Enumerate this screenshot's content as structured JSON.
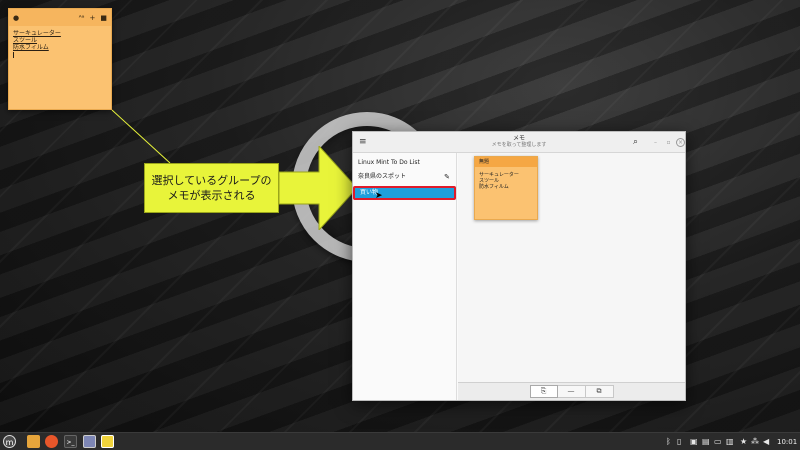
{
  "desktop_note": {
    "lines": [
      "サーキュレーター",
      "スツール",
      "防水フィルム"
    ]
  },
  "callout": {
    "line1": "選択しているグループの",
    "line2": "メモが表示される"
  },
  "app": {
    "title": "メモ",
    "subtitle": "メモを取って整理します"
  },
  "sidebar": {
    "items": [
      {
        "label": "Linux Mint To Do List"
      },
      {
        "label": "奈良県のスポット"
      },
      {
        "label": "買い物"
      }
    ],
    "selected_index": 2
  },
  "note_card": {
    "title": "無題",
    "lines": [
      "サーキュレーター",
      "スツール",
      "防水フィルム"
    ]
  },
  "taskbar": {
    "clock": "10:01"
  },
  "colors": {
    "accent": "#1f9fdc",
    "selection_border": "#e01b2a",
    "note_color": "#fbc271",
    "callout_color": "#e8f43a"
  }
}
